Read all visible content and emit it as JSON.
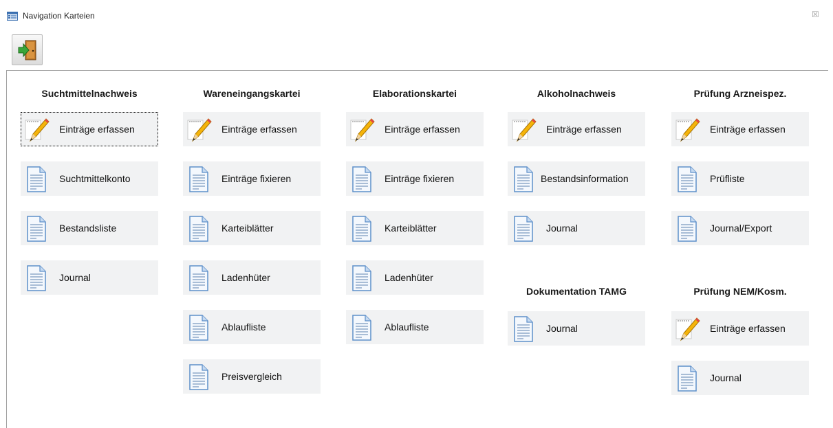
{
  "window": {
    "title": "Navigation Karteien",
    "close_symbol": "☒"
  },
  "toolbar": {
    "exit_icon": "exit-door-icon"
  },
  "colors": {
    "tile_bg": "#f1f2f3",
    "pencil": "#f5b40a",
    "doc": "#5d8fc9"
  },
  "columns": [
    {
      "header": "Suchtmittelnachweis",
      "items": [
        {
          "label": "Einträge erfassen",
          "icon": "pencil"
        },
        {
          "label": "Suchtmittelkonto",
          "icon": "doc"
        },
        {
          "label": "Bestandsliste",
          "icon": "doc"
        },
        {
          "label": "Journal",
          "icon": "doc"
        }
      ]
    },
    {
      "header": "Wareneingangskartei",
      "items": [
        {
          "label": "Einträge erfassen",
          "icon": "pencil"
        },
        {
          "label": "Einträge fixieren",
          "icon": "doc"
        },
        {
          "label": "Karteiblätter",
          "icon": "doc"
        },
        {
          "label": "Ladenhüter",
          "icon": "doc"
        },
        {
          "label": "Ablaufliste",
          "icon": "doc"
        },
        {
          "label": "Preisvergleich",
          "icon": "doc"
        }
      ]
    },
    {
      "header": "Elaborationskartei",
      "items": [
        {
          "label": "Einträge erfassen",
          "icon": "pencil"
        },
        {
          "label": "Einträge fixieren",
          "icon": "doc"
        },
        {
          "label": "Karteiblätter",
          "icon": "doc"
        },
        {
          "label": "Ladenhüter",
          "icon": "doc"
        },
        {
          "label": "Ablaufliste",
          "icon": "doc"
        }
      ]
    },
    {
      "header": "Alkoholnachweis",
      "items": [
        {
          "label": "Einträge erfassen",
          "icon": "pencil"
        },
        {
          "label": "Bestandsinformation",
          "icon": "doc"
        },
        {
          "label": "Journal",
          "icon": "doc"
        }
      ],
      "header2": "Dokumentation TAMG",
      "items2": [
        {
          "label": "Journal",
          "icon": "doc"
        }
      ]
    },
    {
      "header": "Prüfung Arzneispez.",
      "items": [
        {
          "label": "Einträge erfassen",
          "icon": "pencil"
        },
        {
          "label": "Prüfliste",
          "icon": "doc"
        },
        {
          "label": "Journal/Export",
          "icon": "doc"
        }
      ],
      "header2": "Prüfung NEM/Kosm.",
      "items2": [
        {
          "label": "Einträge erfassen",
          "icon": "pencil"
        },
        {
          "label": "Journal",
          "icon": "doc"
        }
      ]
    }
  ]
}
